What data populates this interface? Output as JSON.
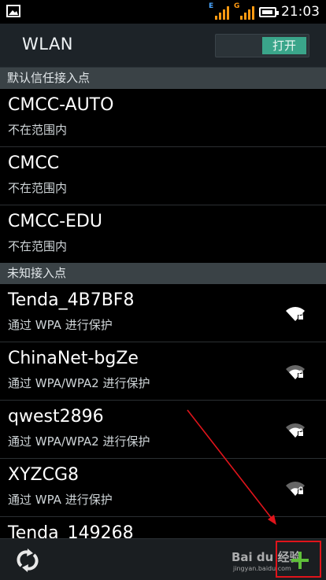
{
  "status_bar": {
    "time": "21:03",
    "signal1_label": "E",
    "signal2_label": "G",
    "icons": [
      "gallery-icon",
      "signal-icon",
      "battery-icon"
    ]
  },
  "action_bar": {
    "title": "WLAN",
    "toggle_label": "打开"
  },
  "sections": {
    "saved": "默认信任接入点",
    "unknown": "未知接入点"
  },
  "saved_networks": [
    {
      "ssid": "CMCC-AUTO",
      "status": "不在范围内"
    },
    {
      "ssid": "CMCC",
      "status": "不在范围内"
    },
    {
      "ssid": "CMCC-EDU",
      "status": "不在范围内"
    }
  ],
  "unknown_networks": [
    {
      "ssid": "Tenda_4B7BF8",
      "status": "通过 WPA 进行保护",
      "signal": 0.95
    },
    {
      "ssid": "ChinaNet-bgZe",
      "status": "通过 WPA/WPA2 进行保护",
      "signal": 0.6
    },
    {
      "ssid": "qwest2896",
      "status": "通过 WPA/WPA2 进行保护",
      "signal": 0.6
    },
    {
      "ssid": "XYZCG8",
      "status": "通过 WPA 进行保护",
      "signal": 0.5
    },
    {
      "ssid": "Tenda_149268",
      "status": ""
    }
  ],
  "bottom_bar": {
    "watermark": "Bai du 经验",
    "watermark_url": "jingyan.baidu.com",
    "icons": [
      "refresh-icon",
      "add-icon"
    ]
  },
  "colors": {
    "accent": "#3aa58a",
    "annotation": "#e0141b",
    "section_bg": "#3a4246"
  }
}
